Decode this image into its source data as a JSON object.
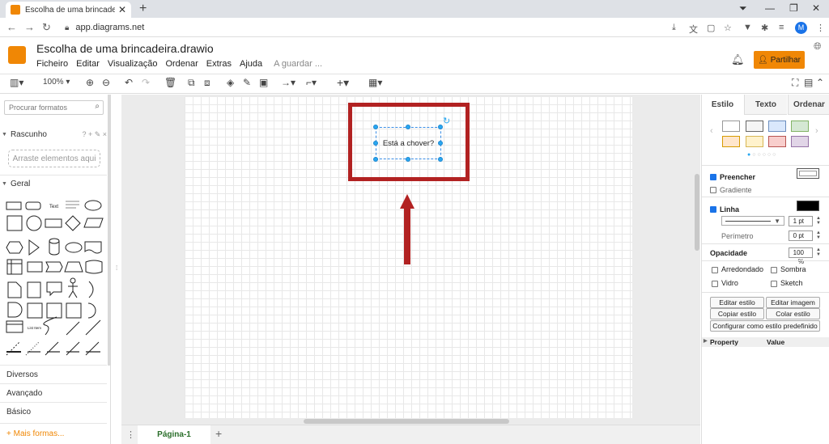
{
  "browser": {
    "tab_title": "Escolha de uma brincadeira.draw",
    "url": "app.diagrams.net",
    "profile_initial": "M"
  },
  "app": {
    "doc_title": "Escolha de uma brincadeira.drawio",
    "menu": [
      "Ficheiro",
      "Editar",
      "Visualização",
      "Ordenar",
      "Extras",
      "Ajuda"
    ],
    "saving_status": "A guardar ...",
    "share_label": "Partilhar"
  },
  "toolbar": {
    "zoom": "100%"
  },
  "left_panel": {
    "search_placeholder": "Procurar formatos",
    "scratchpad": "Rascunho",
    "scratchpad_icons": "? + ✎ ×",
    "drop_hint": "Arraste elementos aqui",
    "general": "Geral",
    "shape_text_label": "Text",
    "shape_list_label": "List Item",
    "sections": [
      "Diversos",
      "Avançado",
      "Básico"
    ],
    "more_shapes": "+ Mais formas..."
  },
  "canvas": {
    "shape_text": "Está a chover?",
    "page_tab": "Página-1"
  },
  "right_panel": {
    "tabs": [
      "Estilo",
      "Texto",
      "Ordenar"
    ],
    "fill_label": "Preencher",
    "gradient_label": "Gradiente",
    "line_label": "Linha",
    "line_width": "1 pt",
    "perimeter_label": "Perímetro",
    "perimeter_value": "0 pt",
    "opacity_label": "Opacidade",
    "opacity_value": "100 %",
    "rounded": "Arredondado",
    "shadow": "Sombra",
    "glass": "Vidro",
    "sketch": "Sketch",
    "edit_style": "Editar estilo",
    "edit_image": "Editar imagem",
    "copy_style": "Copiar estilo",
    "paste_style": "Colar estilo",
    "set_default": "Configurar como estilo predefinido",
    "property_col": "Property",
    "value_col": "Value",
    "swatch_colors": [
      "#ffffff",
      "#f5f5f5",
      "#dae8fc",
      "#d5e8d4",
      "#ffe6cc",
      "#fff2cc",
      "#f8cecc",
      "#e1d5e7"
    ]
  },
  "colors": {
    "accent": "#f08705",
    "annotation_red": "#b22222",
    "selection_blue": "#29a7f0"
  }
}
